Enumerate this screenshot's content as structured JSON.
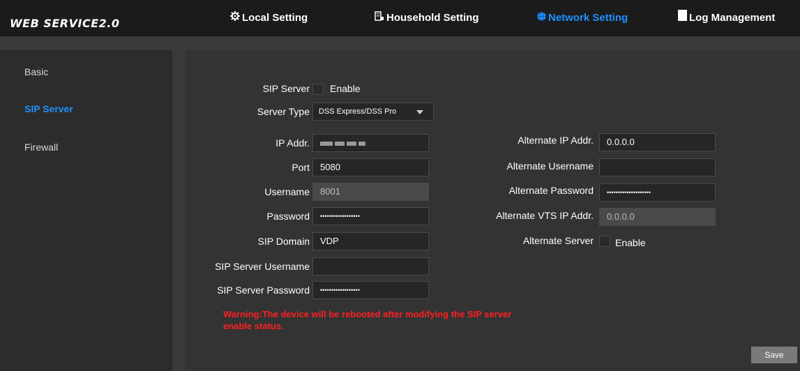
{
  "app": {
    "title": "WEB SERVICE2.0"
  },
  "nav": {
    "local_setting": "Local Setting",
    "household_setting": "Household Setting",
    "network_setting": "Network Setting",
    "log_management": "Log Management"
  },
  "sidebar": {
    "items": [
      {
        "label": "Basic",
        "active": false
      },
      {
        "label": "SIP Server",
        "active": true
      },
      {
        "label": "Firewall",
        "active": false
      }
    ]
  },
  "form": {
    "sip_server_label": "SIP Server",
    "enable_label": "Enable",
    "server_type_label": "Server Type",
    "server_type_value": "DSS Express/DSS Pro",
    "ip_addr_label": "IP Addr.",
    "ip_addr_value": "",
    "port_label": "Port",
    "port_value": "5080",
    "username_label": "Username",
    "username_value": "8001",
    "password_label": "Password",
    "password_value": "••••••••••••••••••",
    "sip_domain_label": "SIP Domain",
    "sip_domain_value": "VDP",
    "sip_server_username_label": "SIP Server Username",
    "sip_server_username_value": "",
    "sip_server_password_label": "SIP Server Password",
    "sip_server_password_value": "••••••••••••••••••",
    "alt_ip_label": "Alternate IP Addr.",
    "alt_ip_value": "0.0.0.0",
    "alt_username_label": "Alternate Username",
    "alt_username_value": "",
    "alt_password_label": "Alternate Password",
    "alt_password_value": "••••••••••••••••••••",
    "alt_vts_label": "Alternate VTS IP Addr.",
    "alt_vts_value": "0.0.0.0",
    "alt_server_label": "Alternate Server",
    "alt_enable_label": "Enable"
  },
  "warning": "Warning:The device will be rebooted after modifying the SIP server enable status.",
  "buttons": {
    "save": "Save"
  },
  "colors": {
    "accent": "#1e90ff",
    "warning": "#ff2020",
    "header_bg": "#1b1b1b",
    "panel_bg": "#333333"
  }
}
